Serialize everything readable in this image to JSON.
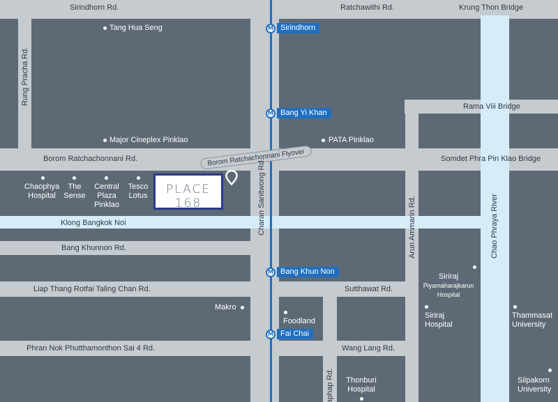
{
  "roads": {
    "sirindhorn": "Sirindhorn Rd.",
    "ratchawithi": "Ratchawithi Rd.",
    "krung_thon_bridge": "Krung Thon Bridge",
    "rung_pracha": "Rung Pracha Rd.",
    "rama_viii_bridge": "Rama Viii Bridge",
    "borom_ratchachonnani": "Borom Ratchachonnani Rd.",
    "borom_flyover": "Borom Ratchachonnani Flyover",
    "somdet_bridge": "Somdet Phra Pin Klao Bridge",
    "charan_sanitwong": "Charan Sanitwong Rd.",
    "klong_bangkok_noi": "Klong Bangkok Noi",
    "arun_ammarin": "Arun Ammarin Rd.",
    "chao_phraya_river": "Chao Phraya River",
    "bang_khunnon": "Bang Khunnon Rd.",
    "liap_thang": "Liap Thang Rotfai Taling Chan Rd.",
    "sutthawat": "Sutthawat Rd.",
    "phran_nok": "Phran Nok Phutthamonthon Sai 4 Rd.",
    "wang_lang": "Wang Lang Rd.",
    "itsaraphap": "raphap Rd."
  },
  "stations": {
    "sirindhorn": "Sirindhorn",
    "bang_yi_khan": "Bang Yi Khan",
    "bang_khun_non": "Bang Khun Non",
    "fai_chai": "Fai Chai",
    "icon_glyph": "M"
  },
  "poi": {
    "tang_hua_seng": "Tang Hua Seng",
    "major_cineplex": "Major Cineplex Pinklao",
    "pata_pinklao": "PATA Pinklao",
    "chaophya_hospital_1": "Chaophya",
    "chaophya_hospital_2": "Hospital",
    "the_sense_1": "The",
    "the_sense_2": "Sense",
    "central_1": "Central",
    "central_2": "Plaza",
    "central_3": "Pinklao",
    "tesco_1": "Tesco",
    "tesco_2": "Lotus",
    "makro": "Makro",
    "foodland": "Foodland",
    "siriraj_piya_1": "Siriraj",
    "siriraj_piya_2": "Piyamaharajkarun",
    "siriraj_piya_3": "Hospital",
    "siriraj_hospital_1": "Siriraj",
    "siriraj_hospital_2": "Hospital",
    "thammasat_1": "Thammasat",
    "thammasat_2": "University",
    "thonburi_1": "Thonburi",
    "thonburi_2": "Hospital",
    "silpakorn_1": "Silpakorn",
    "silpakorn_2": "University"
  },
  "place": {
    "name": "PLACE 168",
    "sub": "PINKLAO"
  },
  "colors": {
    "block": "#5d6a75",
    "road": "#c6cbcf",
    "river": "#d6ecf6",
    "rail": "#1f6fc0",
    "place_border": "#2b3a8c"
  }
}
